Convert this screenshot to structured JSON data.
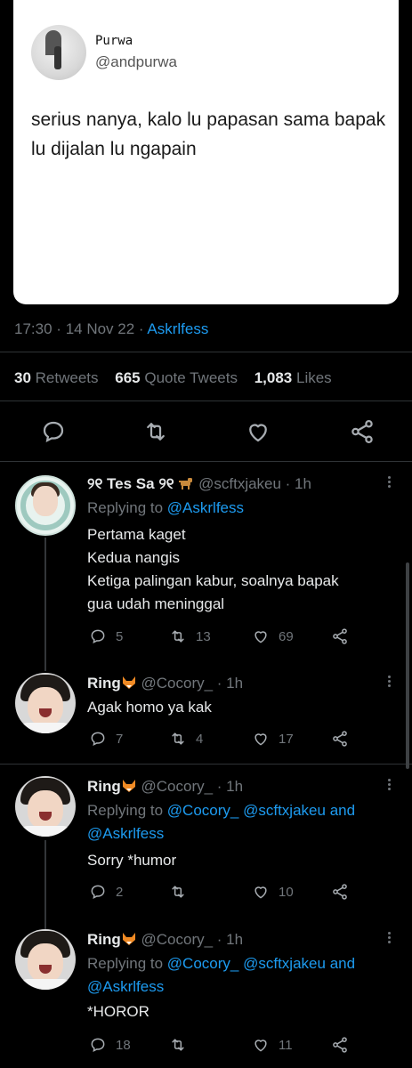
{
  "quoted": {
    "name": "Purwa",
    "handle": "@andpurwa",
    "text": "serius nanya, kalo lu papasan sama bapak lu dijalan lu ngapain"
  },
  "tweet_meta": {
    "time": "17:30",
    "dot1": "·",
    "date": "14 Nov 22",
    "dot2": "·",
    "source": "Askrlfess"
  },
  "stats": {
    "retweets_count": "30",
    "retweets_label": "Retweets",
    "quotes_count": "665",
    "quotes_label": "Quote Tweets",
    "likes_count": "1,083",
    "likes_label": "Likes"
  },
  "replies": [
    {
      "name": "୨୧ Tes Sa ୨୧",
      "name_emoji": "dog-icon",
      "handle": "@scftxjakeu · 1h",
      "replying_prefix": "Replying to",
      "replying_links": [
        "@Askrlfess"
      ],
      "replying_joiner": "",
      "lines": [
        "Pertama kaget",
        "Kedua nangis",
        "Ketiga palingan kabur, soalnya bapak",
        "gua udah meninggal"
      ],
      "reply_count": "5",
      "retweet_count": "13",
      "like_count": "69"
    },
    {
      "name": "Ring",
      "name_emoji": "fox-icon",
      "handle": "@Cocory_ · 1h",
      "lines": [
        "Agak homo ya kak"
      ],
      "reply_count": "7",
      "retweet_count": "4",
      "like_count": "17"
    },
    {
      "name": "Ring",
      "name_emoji": "fox-icon",
      "handle": "@Cocory_ · 1h",
      "replying_prefix": "Replying to",
      "replying_link1": "@Cocory_",
      "replying_link2": "@scftxjakeu",
      "replying_joiner": "and",
      "replying_link3": "@Askrlfess",
      "lines": [
        "Sorry *humor"
      ],
      "reply_count": "2",
      "retweet_count": "",
      "like_count": "10"
    },
    {
      "name": "Ring",
      "name_emoji": "fox-icon",
      "handle": "@Cocory_ · 1h",
      "replying_prefix": "Replying to",
      "replying_link1": "@Cocory_",
      "replying_link2": "@scftxjakeu",
      "replying_joiner": "and",
      "replying_link3": "@Askrlfess",
      "lines": [
        "*HOROR"
      ],
      "reply_count": "18",
      "retweet_count": "",
      "like_count": "11"
    }
  ],
  "colors": {
    "background": "#000000",
    "link": "#1d9bf0",
    "muted": "#71767b",
    "text": "#e7e9ea"
  }
}
